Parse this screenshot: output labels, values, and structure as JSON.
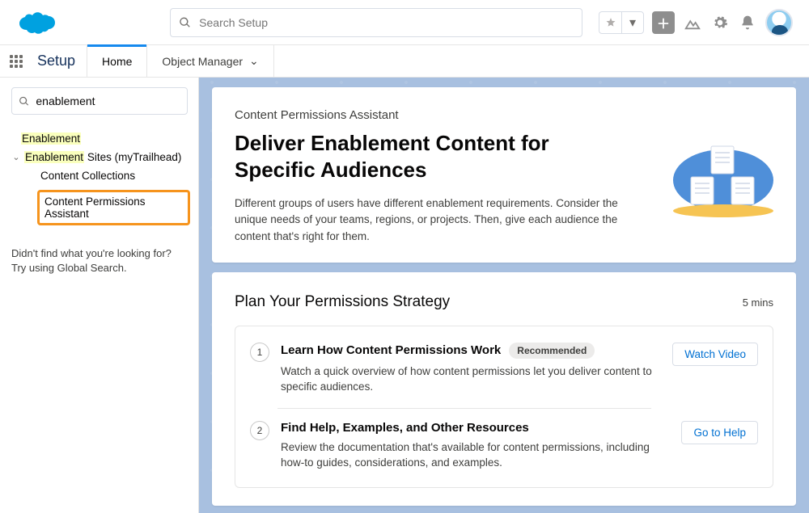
{
  "header": {
    "search_placeholder": "Search Setup"
  },
  "nav": {
    "app_label": "Setup",
    "tabs": [
      {
        "label": "Home",
        "active": true
      },
      {
        "label": "Object Manager",
        "active": false,
        "dropdown": true
      }
    ]
  },
  "sidebar": {
    "search_value": "enablement",
    "tree": {
      "root_label": "Enablement",
      "group_label_hl": "Enablement",
      "group_label_rest": " Sites (myTrailhead)",
      "items": [
        "Content Collections",
        "Content Permissions Assistant"
      ]
    },
    "footer_line1": "Didn't find what you're looking for?",
    "footer_line2": "Try using Global Search."
  },
  "hero": {
    "eyebrow": "Content Permissions Assistant",
    "title": "Deliver Enablement Content for Specific Audiences",
    "desc": "Different groups of users have different enablement requirements. Consider the unique needs of your teams, regions, or projects. Then, give each audience the content that's right for them."
  },
  "section": {
    "title": "Plan Your Permissions Strategy",
    "time": "5 mins",
    "steps": [
      {
        "num": "1",
        "title": "Learn How Content Permissions Work",
        "badge": "Recommended",
        "desc": "Watch a quick overview of how content permissions let you deliver content to specific audiences.",
        "action": "Watch Video"
      },
      {
        "num": "2",
        "title": "Find Help, Examples, and Other Resources",
        "badge": "",
        "desc": "Review the documentation that's available for content permissions, including how-to guides, considerations, and examples.",
        "action": "Go to Help"
      }
    ]
  }
}
